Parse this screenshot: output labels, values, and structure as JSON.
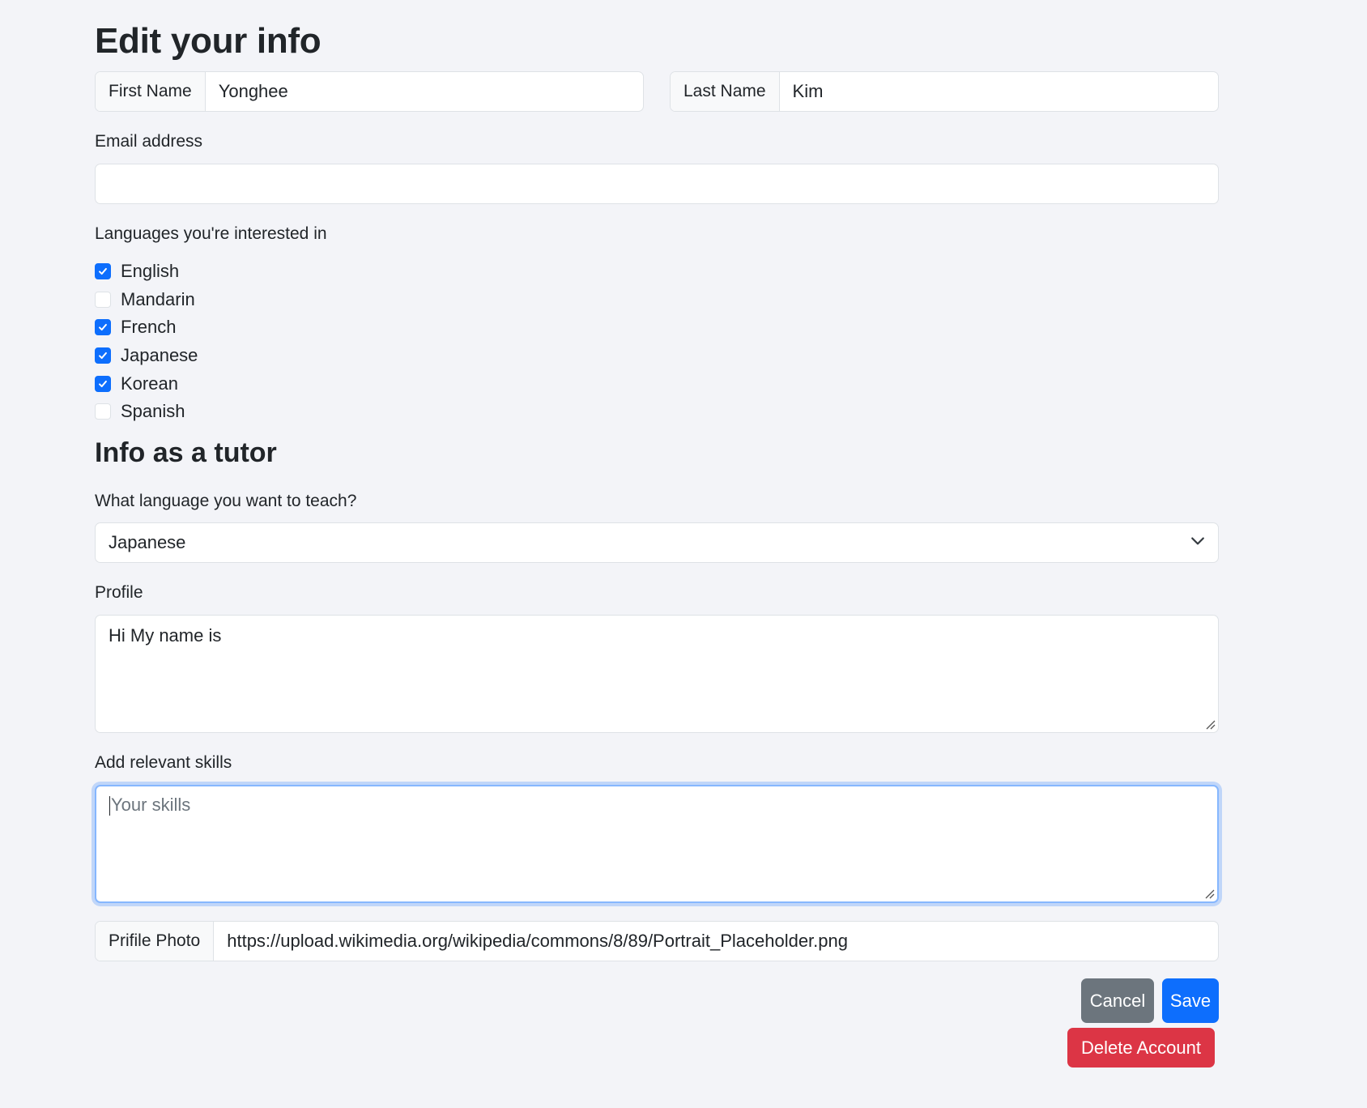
{
  "page_title": "Edit your info",
  "first_name": {
    "label": "First Name",
    "value": "Yonghee"
  },
  "last_name": {
    "label": "Last Name",
    "value": "Kim"
  },
  "email": {
    "label": "Email address",
    "value": ""
  },
  "languages": {
    "label": "Languages you're interested in",
    "options": [
      {
        "label": "English",
        "checked": true
      },
      {
        "label": "Mandarin",
        "checked": false
      },
      {
        "label": "French",
        "checked": true
      },
      {
        "label": "Japanese",
        "checked": true
      },
      {
        "label": "Korean",
        "checked": true
      },
      {
        "label": "Spanish",
        "checked": false
      }
    ]
  },
  "tutor_section_title": "Info as a tutor",
  "teach_language": {
    "label": "What language you want to teach?",
    "value": "Japanese"
  },
  "profile": {
    "label": "Profile",
    "value": "Hi My name is"
  },
  "skills": {
    "label": "Add relevant skills",
    "placeholder": "Your skills",
    "value": ""
  },
  "photo": {
    "label": "Prifile Photo",
    "value": "https://upload.wikimedia.org/wikipedia/commons/8/89/Portrait_Placeholder.png"
  },
  "buttons": {
    "cancel": "Cancel",
    "save": "Save",
    "delete": "Delete Account"
  },
  "colors": {
    "primary": "#0d6efd",
    "secondary": "#6c757d",
    "danger": "#dc3545",
    "background": "#f3f4f8"
  }
}
